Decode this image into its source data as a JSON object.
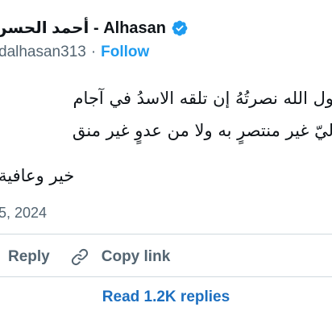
{
  "author": {
    "name": "Alhasan - أحمد الحسن",
    "handle": "dalhasan313",
    "separator": "·",
    "follow_label": "Follow"
  },
  "tweet": {
    "lines": [
      "ول الله نصرتُهُ    إن تلقه الاسدُ في آجام",
      "ليّ غير منتصرٍ  به ولا من عدوٍ غير منق",
      "خير وعافية"
    ],
    "date": "5, 2024"
  },
  "actions": {
    "reply_label": "Reply",
    "copy_link_label": "Copy link"
  },
  "replies_button": "Read 1.2K replies",
  "colors": {
    "accent": "#1d9bf0",
    "secondary_text": "#536471",
    "link_blue": "#1d6fc0"
  }
}
